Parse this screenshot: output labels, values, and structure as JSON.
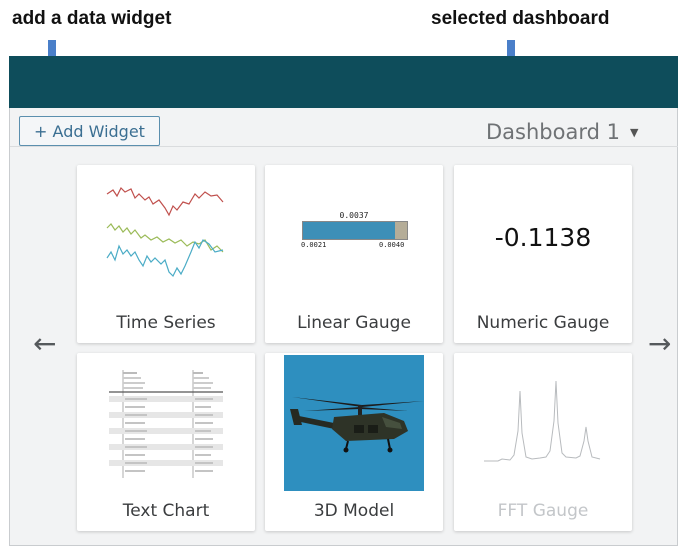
{
  "annotations": {
    "add_widget_note": "add a data widget",
    "selected_dashboard_note": "selected dashboard"
  },
  "toolbar": {
    "add_widget_label": "+ Add Widget",
    "dashboard_selected": "Dashboard 1",
    "dashboard_caret": "▼"
  },
  "nav": {
    "prev_glyph": "←",
    "next_glyph": "→"
  },
  "widgets": [
    {
      "label": "Time Series",
      "icon": "time-series-chart"
    },
    {
      "label": "Linear Gauge",
      "icon": "linear-gauge",
      "gauge": {
        "value": "0.0037",
        "min": "0.0021",
        "max": "0.0040",
        "fill": 0.88
      }
    },
    {
      "label": "Numeric Gauge",
      "icon": "numeric-gauge",
      "value": "-0.1138"
    },
    {
      "label": "Text Chart",
      "icon": "text-table"
    },
    {
      "label": "3D Model",
      "icon": "helicopter-model"
    },
    {
      "label": "FFT Gauge",
      "icon": "fft-spectrum",
      "disabled": true
    }
  ],
  "colors": {
    "topbar": "#0e4d5b",
    "annotation_arrow": "#4a7fc9",
    "gauge_fill": "#3d8fb7",
    "model_background": "#2e8fbf"
  }
}
